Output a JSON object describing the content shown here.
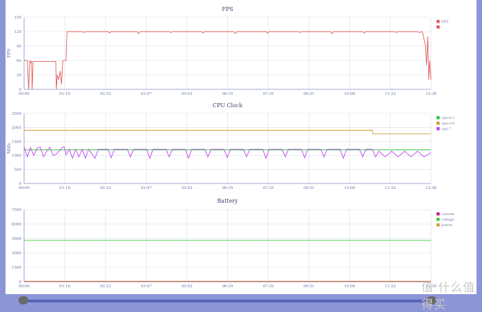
{
  "colors": {
    "grid": "#d8dbe8",
    "axis": "#8890c8",
    "tick_text": "#6a70a8",
    "title_text": "#3c4270",
    "fps": "#e05a5a",
    "cpu_0_2": "#2ec23a",
    "cpu_3_6": "#c99a2a",
    "cpu_7": "#c040f0",
    "current": "#c02090",
    "voltage": "#3ccc3c",
    "power": "#c9a030"
  },
  "watermark": "值 什么值得买",
  "chart_data": [
    {
      "type": "line",
      "title": "FPS",
      "xlabel": "",
      "ylabel": "FPS",
      "ylim": [
        0,
        150
      ],
      "yticks": [
        "0",
        "30",
        "60",
        "90",
        "120",
        "150"
      ],
      "xticks": [
        "00:00",
        "01:16",
        "02:32",
        "03:47",
        "05:03",
        "06:19",
        "07:35",
        "08:51",
        "10:06",
        "11:22",
        "12:38"
      ],
      "grid": true,
      "legend": "top-right",
      "series": [
        {
          "name": "FPS",
          "color_key": "fps",
          "points": [
            [
              0,
              60
            ],
            [
              0.1,
              60
            ],
            [
              0.14,
              0
            ],
            [
              0.18,
              60
            ],
            [
              0.2,
              55
            ],
            [
              0.23,
              58
            ],
            [
              0.25,
              0
            ],
            [
              0.28,
              58
            ],
            [
              0.6,
              58
            ],
            [
              0.98,
              58
            ],
            [
              1.0,
              0
            ],
            [
              1.03,
              30
            ],
            [
              1.07,
              20
            ],
            [
              1.12,
              38
            ],
            [
              1.16,
              10
            ],
            [
              1.2,
              60
            ],
            [
              1.3,
              60
            ],
            [
              1.33,
              120
            ],
            [
              1.5,
              120
            ],
            [
              1.8,
              120
            ],
            [
              1.85,
              118
            ],
            [
              1.9,
              120
            ],
            [
              2.6,
              120
            ],
            [
              2.65,
              117
            ],
            [
              2.7,
              120
            ],
            [
              3.5,
              120
            ],
            [
              3.55,
              116
            ],
            [
              3.6,
              120
            ],
            [
              4.5,
              120
            ],
            [
              4.55,
              118
            ],
            [
              4.6,
              120
            ],
            [
              5.5,
              120
            ],
            [
              5.55,
              117
            ],
            [
              5.6,
              120
            ],
            [
              6.5,
              120
            ],
            [
              6.55,
              116
            ],
            [
              6.6,
              120
            ],
            [
              7.5,
              120
            ],
            [
              7.55,
              117
            ],
            [
              7.6,
              120
            ],
            [
              8.5,
              120
            ],
            [
              8.55,
              118
            ],
            [
              8.6,
              120
            ],
            [
              9.5,
              120
            ],
            [
              9.55,
              116
            ],
            [
              9.6,
              120
            ],
            [
              10.5,
              120
            ],
            [
              10.55,
              117
            ],
            [
              10.6,
              120
            ],
            [
              11.5,
              120
            ],
            [
              11.55,
              118
            ],
            [
              11.6,
              120
            ],
            [
              12.2,
              120
            ],
            [
              12.25,
              118
            ],
            [
              12.35,
              120
            ],
            [
              12.45,
              90
            ],
            [
              12.48,
              50
            ],
            [
              12.52,
              110
            ],
            [
              12.55,
              20
            ],
            [
              12.58,
              60
            ],
            [
              12.62,
              20
            ]
          ]
        },
        {
          "name": "",
          "color_key": "fps",
          "points": []
        }
      ]
    },
    {
      "type": "line",
      "title": "CPU Clock",
      "xlabel": "",
      "ylabel": "MHz",
      "ylim": [
        0,
        2500
      ],
      "yticks": [
        "0",
        "500",
        "1000",
        "1500",
        "2000",
        "2500"
      ],
      "xticks": [
        "00:00",
        "01:16",
        "02:32",
        "03:47",
        "05:03",
        "06:19",
        "07:35",
        "08:51",
        "10:06",
        "11:22",
        "12:38"
      ],
      "grid": true,
      "legend": "top-right",
      "series": [
        {
          "name": "cpu:0-2",
          "color_key": "cpu_0_2",
          "points": [
            [
              0,
              1200
            ],
            [
              12.62,
              1200
            ]
          ]
        },
        {
          "name": "cpu:3-6",
          "color_key": "cpu_3_6",
          "points": [
            [
              0,
              1900
            ],
            [
              10.8,
              1900
            ],
            [
              10.82,
              1770
            ],
            [
              12.62,
              1770
            ]
          ]
        },
        {
          "name": "cpu:7",
          "color_key": "cpu_7",
          "points": [
            [
              0,
              1300
            ],
            [
              0.1,
              950
            ],
            [
              0.2,
              1280
            ],
            [
              0.3,
              1000
            ],
            [
              0.4,
              1250
            ],
            [
              0.5,
              1300
            ],
            [
              0.6,
              950
            ],
            [
              0.7,
              1150
            ],
            [
              0.8,
              1300
            ],
            [
              0.9,
              1000
            ],
            [
              1.0,
              1050
            ],
            [
              1.2,
              1300
            ],
            [
              1.25,
              1300
            ],
            [
              1.3,
              1020
            ],
            [
              1.4,
              1220
            ],
            [
              1.5,
              900
            ],
            [
              1.6,
              1220
            ],
            [
              1.7,
              950
            ],
            [
              1.8,
              1220
            ],
            [
              1.9,
              900
            ],
            [
              2.0,
              1220
            ],
            [
              2.2,
              900
            ],
            [
              2.3,
              1220
            ],
            [
              2.6,
              1220
            ],
            [
              2.7,
              920
            ],
            [
              2.8,
              1220
            ],
            [
              3.2,
              1220
            ],
            [
              3.3,
              950
            ],
            [
              3.4,
              1220
            ],
            [
              3.8,
              1220
            ],
            [
              3.9,
              900
            ],
            [
              4.0,
              1220
            ],
            [
              4.4,
              1220
            ],
            [
              4.5,
              950
            ],
            [
              4.6,
              1220
            ],
            [
              5.0,
              1220
            ],
            [
              5.1,
              900
            ],
            [
              5.2,
              1220
            ],
            [
              5.6,
              1220
            ],
            [
              5.7,
              950
            ],
            [
              5.8,
              1220
            ],
            [
              6.2,
              1220
            ],
            [
              6.3,
              920
            ],
            [
              6.4,
              1220
            ],
            [
              6.8,
              1220
            ],
            [
              6.9,
              950
            ],
            [
              7.0,
              1220
            ],
            [
              7.4,
              1220
            ],
            [
              7.5,
              900
            ],
            [
              7.6,
              1220
            ],
            [
              8.0,
              1220
            ],
            [
              8.1,
              950
            ],
            [
              8.2,
              1220
            ],
            [
              8.6,
              1220
            ],
            [
              8.7,
              920
            ],
            [
              8.8,
              1220
            ],
            [
              9.2,
              1220
            ],
            [
              9.3,
              950
            ],
            [
              9.4,
              1220
            ],
            [
              9.8,
              1220
            ],
            [
              9.9,
              900
            ],
            [
              10.0,
              1220
            ],
            [
              10.4,
              1220
            ],
            [
              10.5,
              950
            ],
            [
              10.6,
              1220
            ],
            [
              10.8,
              1220
            ],
            [
              10.9,
              950
            ],
            [
              11.0,
              1150
            ],
            [
              11.2,
              950
            ],
            [
              11.4,
              1150
            ],
            [
              11.6,
              950
            ],
            [
              11.8,
              1150
            ],
            [
              12.0,
              950
            ],
            [
              12.2,
              1150
            ],
            [
              12.4,
              950
            ],
            [
              12.62,
              1100
            ]
          ]
        }
      ]
    },
    {
      "type": "line",
      "title": "Battery",
      "xlabel": "",
      "ylabel": "",
      "ylim": [
        0,
        7500
      ],
      "yticks": [
        "0",
        "1500",
        "3000",
        "4500",
        "6000",
        "7500"
      ],
      "xticks": [
        "00:00",
        "01:16",
        "02:32",
        "03:47",
        "05:03",
        "06:19",
        "07:35",
        "08:51",
        "10:06",
        "11:22",
        "12:38"
      ],
      "grid": true,
      "legend": "top-right",
      "series": [
        {
          "name": "current",
          "color_key": "current",
          "points": [
            [
              0,
              20
            ],
            [
              12.62,
              20
            ]
          ]
        },
        {
          "name": "voltage",
          "color_key": "voltage",
          "points": [
            [
              0,
              4300
            ],
            [
              12.62,
              4300
            ]
          ]
        },
        {
          "name": "power",
          "color_key": "power",
          "points": [
            [
              0,
              60
            ],
            [
              12.62,
              60
            ]
          ]
        }
      ]
    }
  ]
}
